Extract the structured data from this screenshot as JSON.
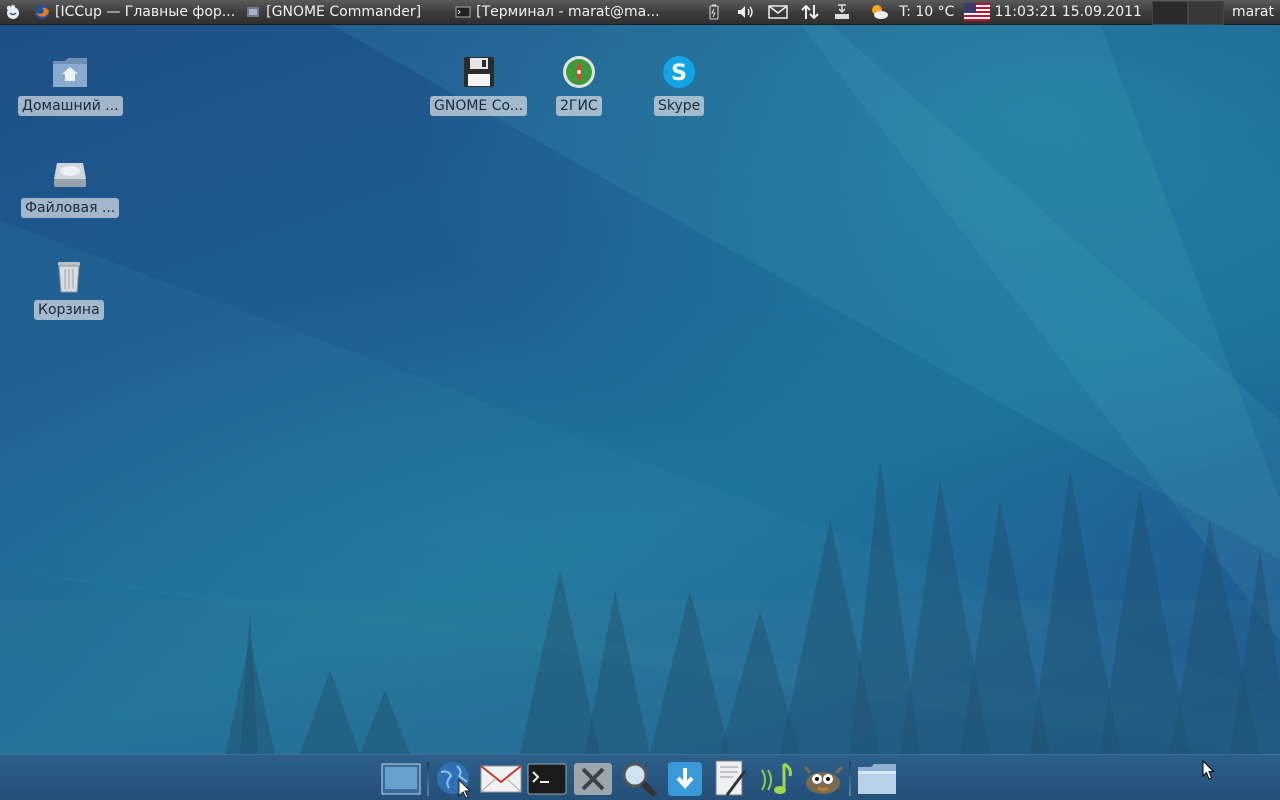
{
  "top_panel": {
    "tasks": [
      {
        "label": "[ICCup — Главные фор...",
        "icon": "firefox-icon"
      },
      {
        "label": "[GNOME Commander]",
        "icon": "file-manager-icon"
      },
      {
        "label": "[Терминал - marat@ma...",
        "icon": "terminal-icon"
      }
    ],
    "temperature": "T: 10 °C",
    "clock": "11:03:21 15.09.2011",
    "user": "marat"
  },
  "desktop_icons": [
    {
      "label": "Домашний ...",
      "icon": "home-folder-icon"
    },
    {
      "label": "Файловая ...",
      "icon": "drive-icon"
    },
    {
      "label": "Корзина",
      "icon": "trash-icon"
    },
    {
      "label": "GNOME Co...",
      "icon": "floppy-icon"
    },
    {
      "label": "2ГИС",
      "icon": "compass-icon"
    },
    {
      "label": "Skype",
      "icon": "skype-icon"
    }
  ],
  "dock_items": [
    "show-desktop-icon",
    "web-browser-icon",
    "mail-icon",
    "terminal-icon",
    "settings-icon",
    "search-icon",
    "download-icon",
    "text-editor-icon",
    "music-player-icon",
    "gimp-icon",
    "file-manager-icon"
  ],
  "colors": {
    "panel": "#3c3c3c",
    "dock": "#2a5880",
    "wallpaper": "#1d5d93"
  }
}
